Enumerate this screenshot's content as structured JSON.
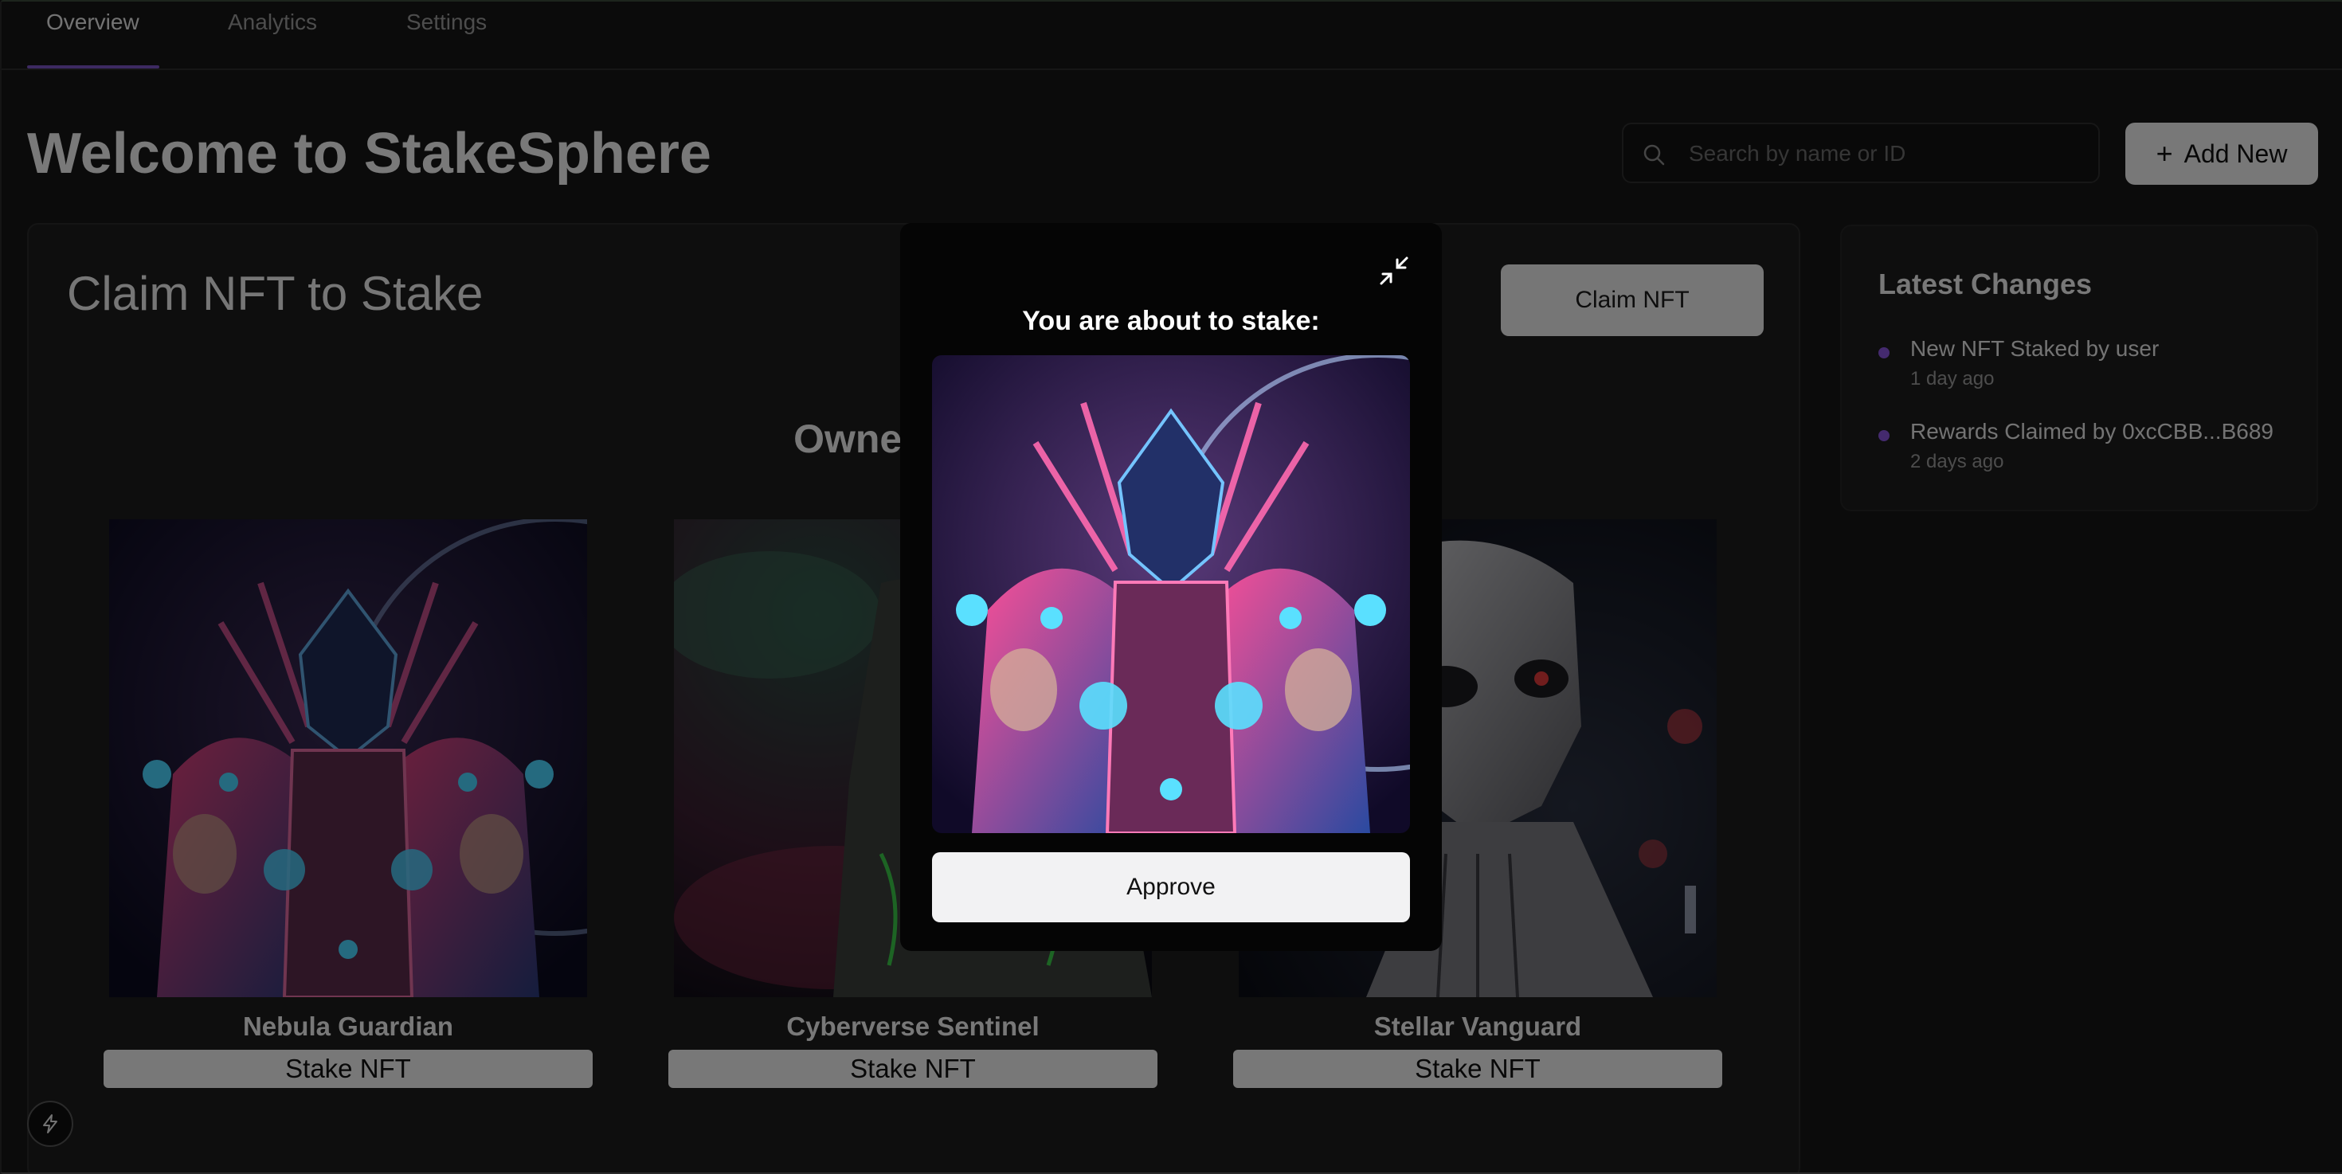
{
  "tabs": [
    {
      "label": "Overview",
      "active": true
    },
    {
      "label": "Analytics",
      "active": false
    },
    {
      "label": "Settings",
      "active": false
    }
  ],
  "header": {
    "title": "Welcome to StakeSphere",
    "search_placeholder": "Search by name or ID",
    "search_icon": "search-icon",
    "add_new_label": "Add New"
  },
  "claim_card": {
    "title": "Claim NFT to Stake",
    "claim_button_label": "Claim NFT",
    "owned_title": "Owned NFTs",
    "nfts": [
      {
        "name": "Nebula Guardian",
        "button_label": "Stake NFT"
      },
      {
        "name": "Cyberverse Sentinel",
        "button_label": "Stake NFT"
      },
      {
        "name": "Stellar Vanguard",
        "button_label": "Stake NFT"
      }
    ]
  },
  "sidebar": {
    "title": "Latest Changes",
    "changes": [
      {
        "text": "New NFT Staked by user",
        "time": "1 day ago"
      },
      {
        "text": "Rewards Claimed by 0xcCBB...B689",
        "time": "2 days ago"
      }
    ]
  },
  "modal": {
    "title": "You are about to stake:",
    "approve_label": "Approve",
    "collapse_icon": "minimize-icon"
  },
  "colors": {
    "accent": "#7b54c4",
    "change_dot": "#8855dd",
    "background": "#161616"
  }
}
